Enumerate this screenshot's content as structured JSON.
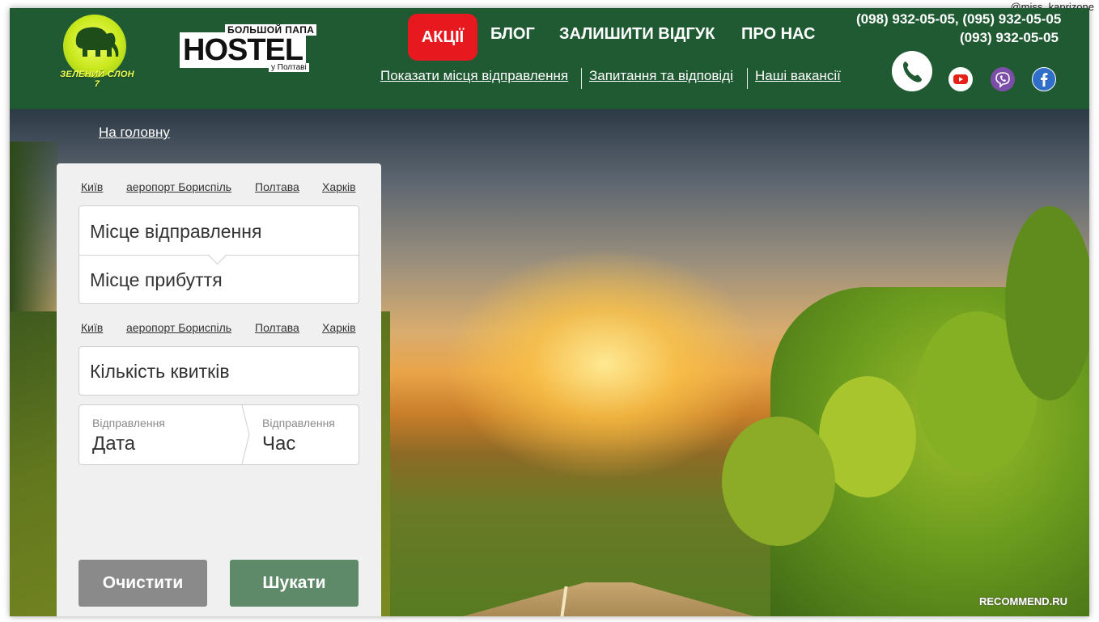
{
  "watermark": {
    "top": "@miss_kaprizone",
    "bottom": "RECOMMEND.RU"
  },
  "logo_elephant": {
    "text": "ЗЕЛЕНИЙ СЛОН 7"
  },
  "logo_hostel": {
    "top": "БОЛЬШОЙ ПАПА",
    "main": "HOSTEL",
    "sub": "у Полтаві"
  },
  "nav": {
    "promo": "АКЦІЇ",
    "blog": "БЛОГ",
    "review": "ЗАЛИШИТИ ВІДГУК",
    "about": "ПРО НАС"
  },
  "sublinks": {
    "departure_places": "Показати місця відправлення",
    "faq": "Запитання та відповіді",
    "vacancies": "Наші вакансії"
  },
  "phones": {
    "line1": "(098) 932-05-05, (095) 932-05-05",
    "line2": "(093) 932-05-05"
  },
  "icons": {
    "phone": "phone-icon",
    "youtube": "youtube-icon",
    "viber": "viber-icon",
    "facebook": "facebook-icon"
  },
  "colors": {
    "header_bg": "#1f5a32",
    "promo_bg": "#e8181f",
    "search_btn": "#5e8a69",
    "clear_btn": "#8a8a8a"
  },
  "breadcrumb": {
    "home": "На головну"
  },
  "search": {
    "quick_from": [
      "Київ",
      "аеропорт Бориспіль",
      "Полтава",
      "Харків"
    ],
    "quick_to": [
      "Київ",
      "аеропорт Бориспіль",
      "Полтава",
      "Харків"
    ],
    "from_placeholder": "Місце відправлення",
    "to_placeholder": "Місце прибуття",
    "tickets_placeholder": "Кількість квитків",
    "date_label": "Відправлення",
    "date_value": "Дата",
    "time_label": "Відправлення",
    "time_value": "Час",
    "clear_button": "Очистити",
    "search_button": "Шукати"
  }
}
